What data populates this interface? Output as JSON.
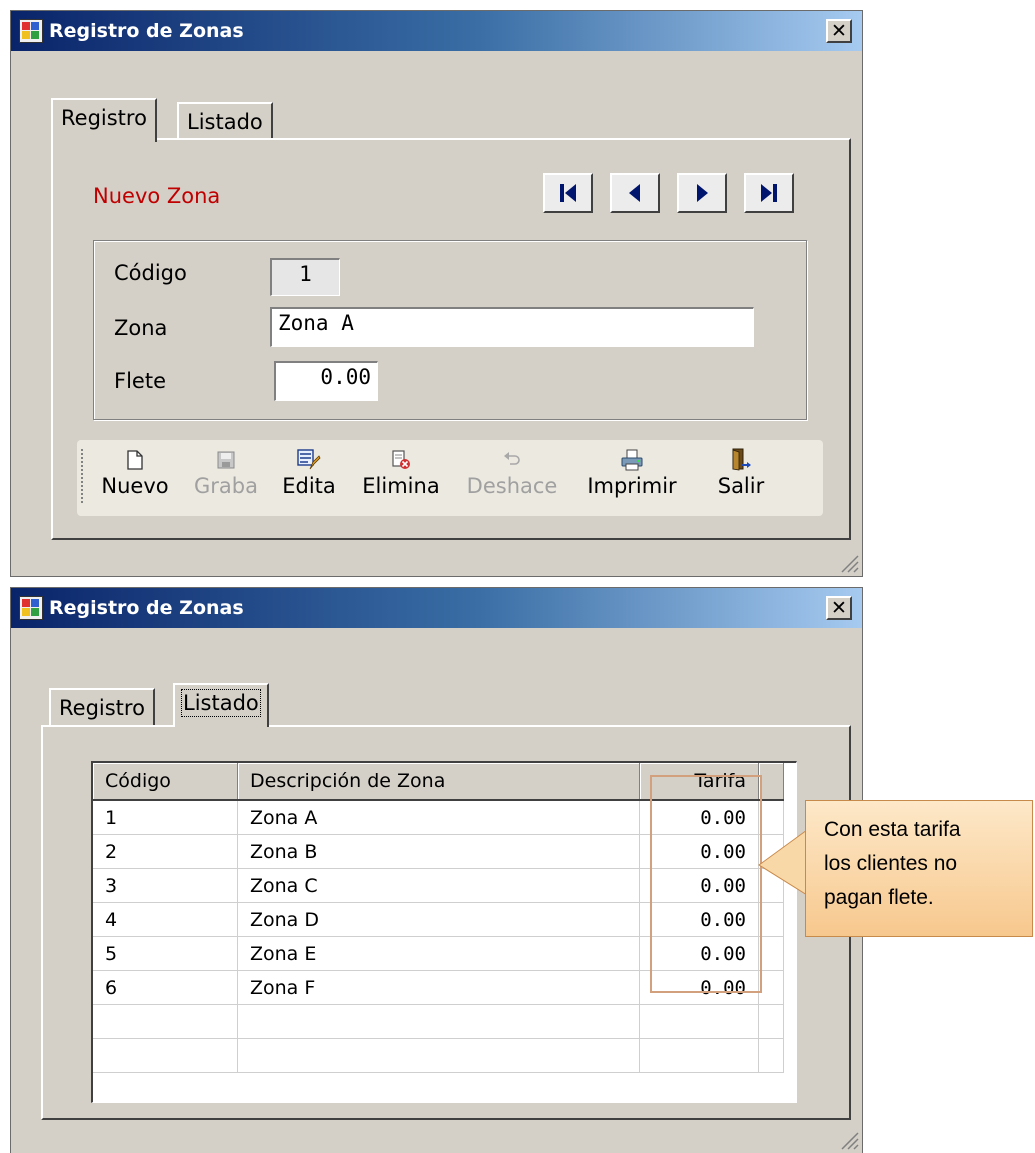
{
  "window1": {
    "title": "Registro de Zonas",
    "close_label": "✕",
    "tabs": [
      {
        "label": "Registro"
      },
      {
        "label": "Listado"
      }
    ],
    "status_label": "Nuevo Zona",
    "status_color": "#c00000",
    "form": {
      "codigo_label": "Código",
      "codigo_value": "1",
      "zona_label": "Zona",
      "zona_value": "Zona A",
      "flete_label": "Flete",
      "flete_value": "0.00"
    },
    "toolbar": {
      "items": [
        {
          "label": "Nuevo",
          "icon": "new-document-icon",
          "enabled": true
        },
        {
          "label": "Graba",
          "icon": "save-disk-icon",
          "enabled": false
        },
        {
          "label": "Edita",
          "icon": "edit-icon",
          "enabled": true
        },
        {
          "label": "Elimina",
          "icon": "delete-icon",
          "enabled": true
        },
        {
          "label": "Deshace",
          "icon": "undo-icon",
          "enabled": false
        },
        {
          "label": "Imprimir",
          "icon": "printer-icon",
          "enabled": true
        },
        {
          "label": "Salir",
          "icon": "exit-door-icon",
          "enabled": true
        }
      ]
    }
  },
  "window2": {
    "title": "Registro de Zonas",
    "tabs": [
      {
        "label": "Registro"
      },
      {
        "label": "Listado"
      }
    ],
    "grid": {
      "columns": [
        "Código",
        "Descripción de Zona",
        "Tarifa"
      ],
      "rows": [
        {
          "codigo": "1",
          "descripcion": "Zona A",
          "tarifa": "0.00"
        },
        {
          "codigo": "2",
          "descripcion": "Zona B",
          "tarifa": "0.00"
        },
        {
          "codigo": "3",
          "descripcion": "Zona C",
          "tarifa": "0.00"
        },
        {
          "codigo": "4",
          "descripcion": "Zona D",
          "tarifa": "0.00"
        },
        {
          "codigo": "5",
          "descripcion": "Zona E",
          "tarifa": "0.00"
        },
        {
          "codigo": "6",
          "descripcion": "Zona F",
          "tarifa": "0.00"
        }
      ]
    }
  },
  "callout": {
    "lines": [
      "Con esta tarifa",
      "los clientes no",
      "pagan flete."
    ]
  }
}
